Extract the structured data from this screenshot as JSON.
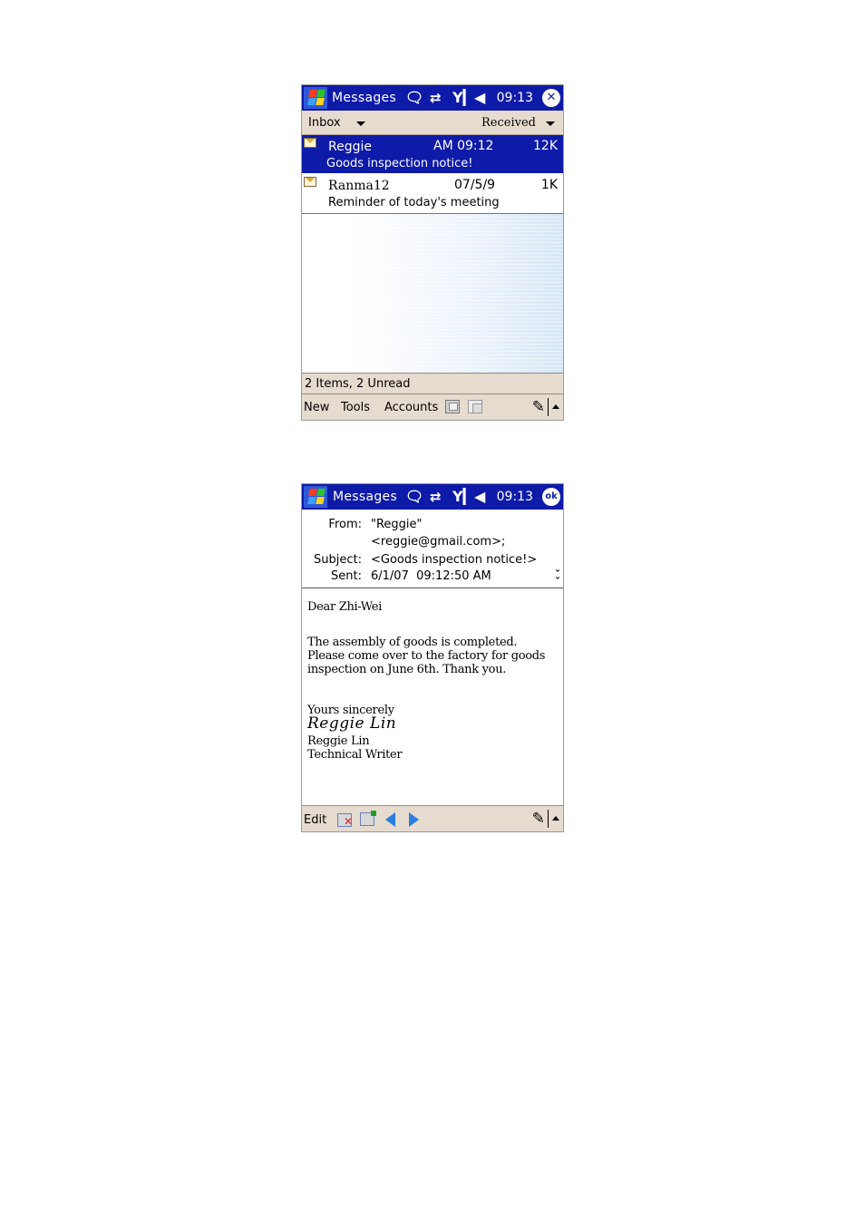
{
  "inbox_screen": {
    "titlebar": {
      "app_title": "Messages",
      "time": "09:13",
      "close_icon": "close-icon",
      "tray_icons": [
        "notification-icon",
        "connectivity-icon",
        "signal-icon",
        "volume-icon"
      ]
    },
    "filter": {
      "folder": "Inbox",
      "sort": "Received"
    },
    "messages": [
      {
        "sender": "Reggie",
        "time": "AM 09:12",
        "size": "12K",
        "subject": "Goods inspection notice!",
        "selected": true,
        "icon": "envelope-icon"
      },
      {
        "sender": "Ranma12",
        "time": "07/5/9",
        "size": "1K",
        "subject": "Reminder of today's meeting",
        "selected": false,
        "icon": "envelope-icon"
      }
    ],
    "status": "2 Items, 2 Unread",
    "menu": {
      "items": [
        "New",
        "Tools",
        "Accounts"
      ]
    }
  },
  "message_screen": {
    "titlebar": {
      "app_title": "Messages",
      "time": "09:13",
      "ok_label": "ok"
    },
    "header": {
      "from_label": "From:",
      "from_name": "\"Reggie\"",
      "from_email": "<reggie@gmail.com>;",
      "subject_label": "Subject:",
      "subject": "<Goods inspection notice!>",
      "sent_label": "Sent:",
      "sent": "6/1/07  09:12:50 AM"
    },
    "body": {
      "greeting": "Dear Zhi-Wei",
      "line1": "The assembly of goods is completed.",
      "line2": "Please come over to the factory for goods",
      "line3": "inspection on June 6th. Thank you.",
      "closing": "Yours sincerely",
      "signature": "Reggie Lin",
      "name": "Reggie Lin",
      "title": "Technical Writer"
    },
    "menu": {
      "edit": "Edit"
    }
  },
  "colors": {
    "titlebar": "#0e1aa8",
    "bars": "#e6dbcf",
    "selection": "#0e1aa8"
  }
}
